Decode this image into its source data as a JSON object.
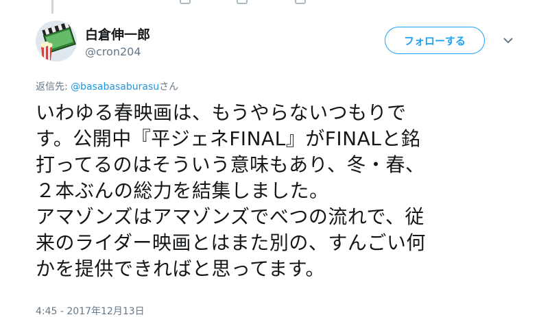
{
  "user": {
    "display_name": "白倉伸一郎",
    "handle": "@cron204",
    "avatar": "clapperboard-popcorn-avatar"
  },
  "follow_button": {
    "label": "フォローする"
  },
  "menu_icon": "chevron-down-icon",
  "reply": {
    "prefix": "返信先: ",
    "mention": "@basabasaburasu",
    "suffix": "さん"
  },
  "tweet": {
    "lines": [
      "いわゆる春映画は、もうやらないつもりで",
      "す。公開中『平ジェネFINAL』がFINALと銘",
      "打ってるのはそういう意味もあり、冬・春、",
      "２本ぶんの総力を結集しました。",
      "アマゾンズはアマゾンズでべつの流れで、従",
      "来のライダー映画とはまた別の、すんごい何",
      "かを提供できればと思ってます。"
    ]
  },
  "timestamp": "4:45 - 2017年12月13日",
  "colors": {
    "accent": "#1da1f2",
    "mention": "#1b95e0",
    "muted_text": "#657786",
    "primary_text": "#14171a"
  }
}
